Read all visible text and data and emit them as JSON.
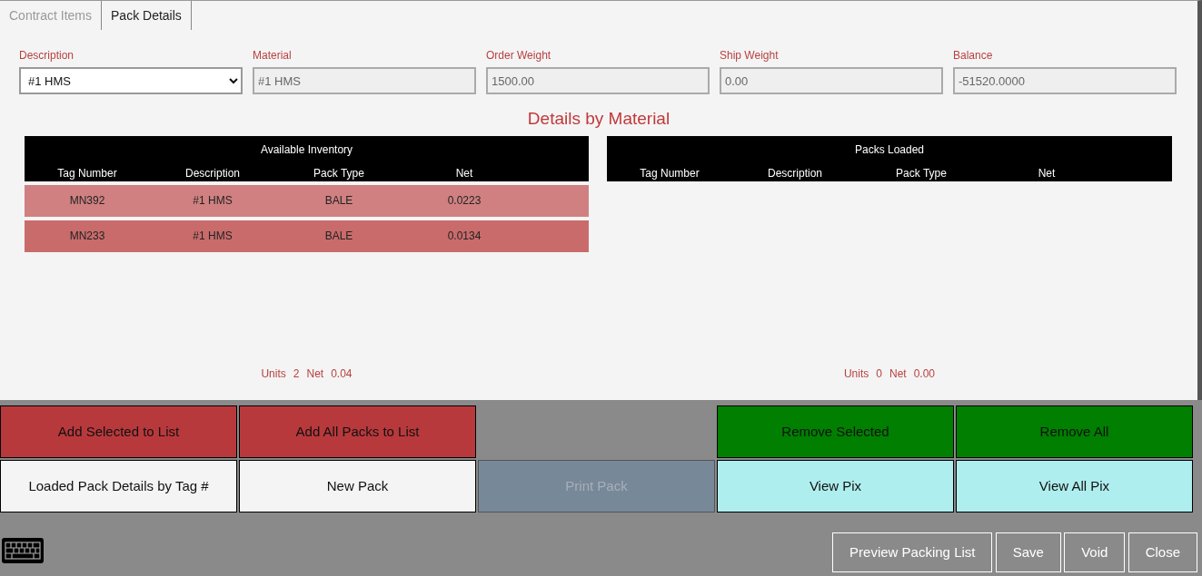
{
  "tabs": [
    {
      "label": "Contract Items",
      "selected": false
    },
    {
      "label": "Pack Details",
      "selected": true
    }
  ],
  "fields": [
    {
      "label": "Description",
      "kind": "select",
      "value": "#1 HMS"
    },
    {
      "label": "Material",
      "kind": "readonly",
      "value": "#1 HMS"
    },
    {
      "label": "Order Weight",
      "kind": "readonly",
      "value": "1500.00"
    },
    {
      "label": "Ship Weight",
      "kind": "readonly",
      "value": "0.00"
    },
    {
      "label": "Balance",
      "kind": "readonly",
      "value": "-51520.0000"
    }
  ],
  "section_title": "Details by Material",
  "tables": [
    {
      "title": "Available Inventory",
      "columns": [
        "Tag Number",
        "Description",
        "Pack Type",
        "Net"
      ],
      "rows": [
        {
          "cells": [
            "MN392",
            "#1 HMS",
            "BALE",
            "0.0223"
          ],
          "selected": false
        },
        {
          "cells": [
            "MN233",
            "#1 HMS",
            "BALE",
            "0.0134"
          ],
          "selected": true
        }
      ],
      "summary": {
        "units_label": "Units",
        "units": "2",
        "net_label": "Net",
        "net": "0.04"
      }
    },
    {
      "title": "Packs Loaded",
      "columns": [
        "Tag Number",
        "Description",
        "Pack Type",
        "Net"
      ],
      "summary": {
        "units_label": "Units",
        "units": "0",
        "net_label": "Net",
        "net": "0.00"
      }
    }
  ],
  "action_buttons": [
    {
      "label": "Add Selected to List",
      "kind": "add",
      "disabled": false
    },
    {
      "label": "Add All Packs to List",
      "kind": "add",
      "disabled": false
    },
    {
      "kind": "spacer"
    },
    {
      "label": "Remove Selected",
      "kind": "remove",
      "disabled": false
    },
    {
      "label": "Remove All",
      "kind": "remove",
      "disabled": false
    },
    {
      "label": "Loaded Pack Details by Tag #",
      "kind": "plain",
      "disabled": false
    },
    {
      "label": "New Pack",
      "kind": "plain",
      "disabled": false
    },
    {
      "label": "Print Pack",
      "kind": "plain",
      "disabled": true
    },
    {
      "label": "View Pix",
      "kind": "pix",
      "disabled": false
    },
    {
      "label": "View All Pix",
      "kind": "pix",
      "disabled": false
    }
  ],
  "footer_buttons": [
    "Preview Packing List",
    "Save",
    "Void",
    "Close"
  ]
}
